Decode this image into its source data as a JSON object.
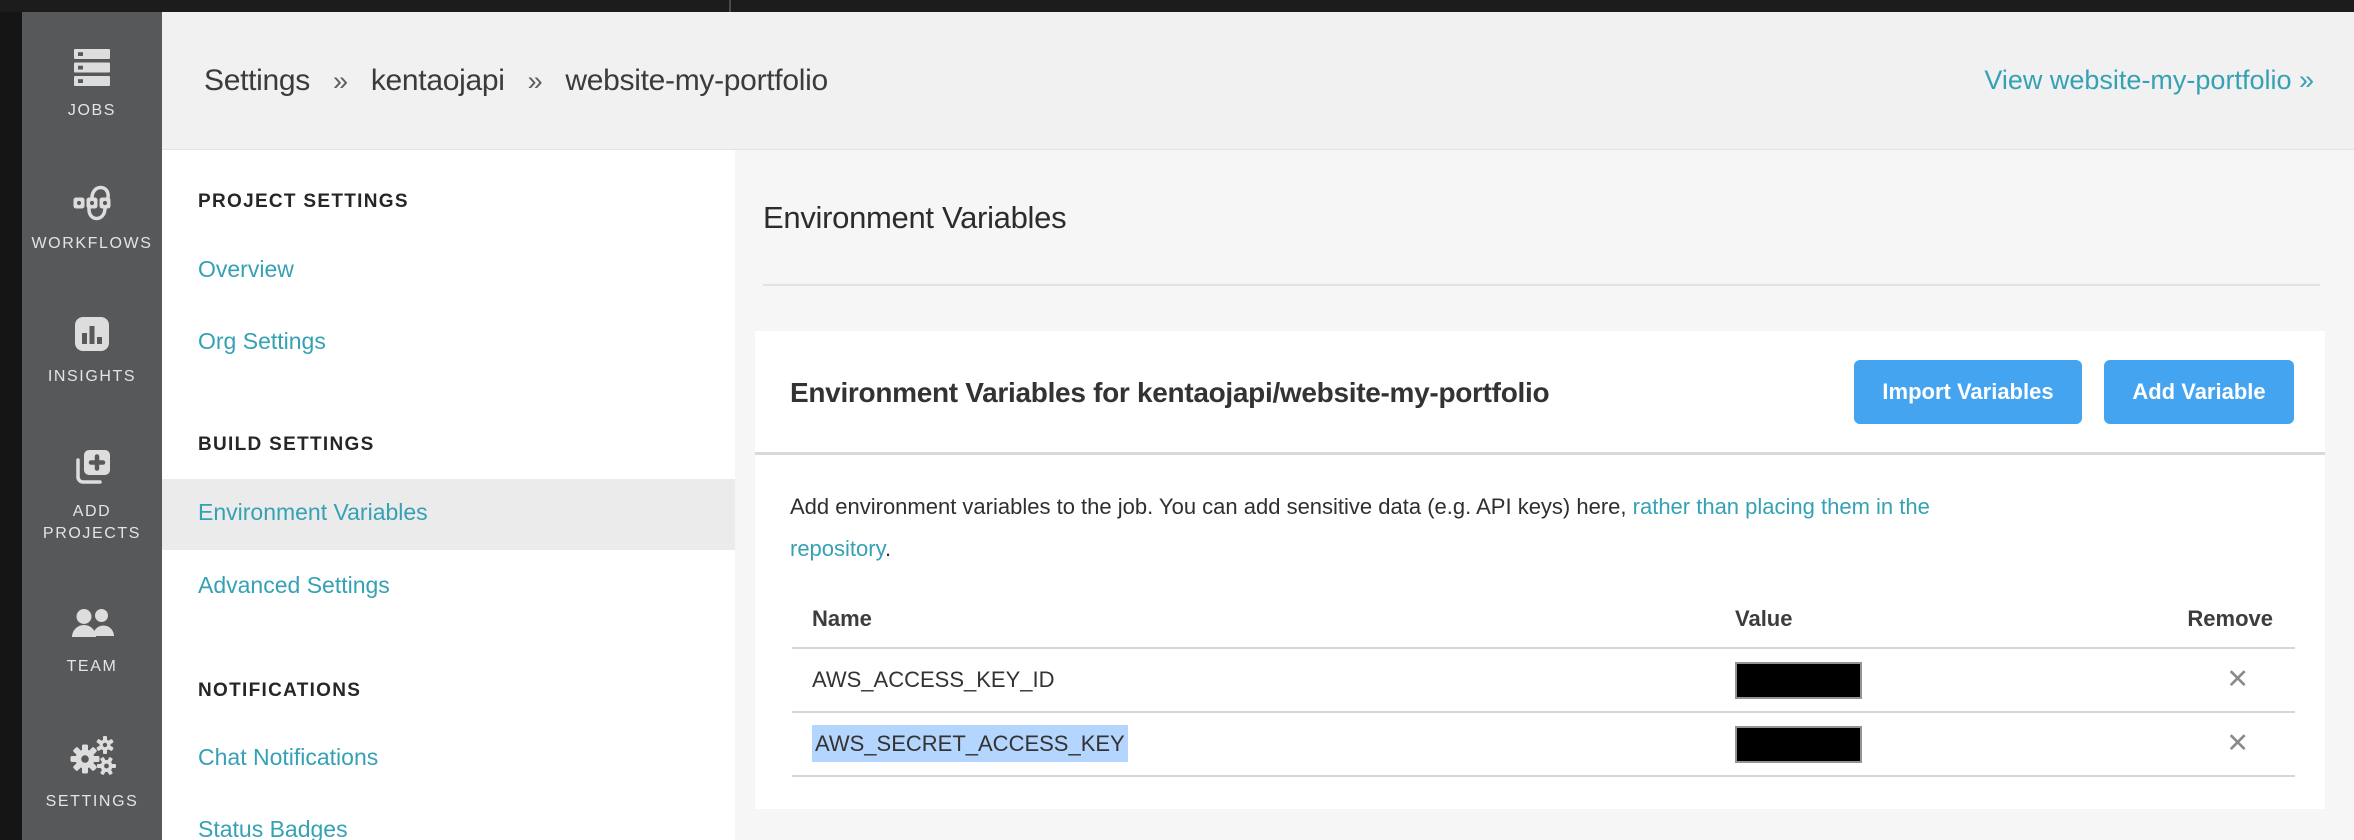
{
  "sidebar": {
    "items": [
      {
        "label": "JOBS",
        "icon": "jobs-icon"
      },
      {
        "label": "WORKFLOWS",
        "icon": "workflows-icon"
      },
      {
        "label": "INSIGHTS",
        "icon": "insights-icon"
      },
      {
        "label": "ADD PROJECTS",
        "icon": "add-projects-icon"
      },
      {
        "label": "TEAM",
        "icon": "team-icon"
      },
      {
        "label": "SETTINGS",
        "icon": "settings-icon"
      }
    ]
  },
  "header": {
    "breadcrumb": {
      "parts": [
        "Settings",
        "kentaojapi",
        "website-my-portfolio"
      ],
      "separator": "»"
    },
    "view_link": "View website-my-portfolio »"
  },
  "nav": {
    "sections": [
      {
        "heading": "PROJECT SETTINGS",
        "items": [
          {
            "label": "Overview"
          },
          {
            "label": "Org Settings"
          }
        ]
      },
      {
        "heading": "BUILD SETTINGS",
        "items": [
          {
            "label": "Environment Variables"
          },
          {
            "label": "Advanced Settings"
          }
        ]
      },
      {
        "heading": "NOTIFICATIONS",
        "items": [
          {
            "label": "Chat Notifications"
          },
          {
            "label": "Status Badges"
          }
        ]
      }
    ],
    "active_item": "Environment Variables"
  },
  "main": {
    "page_title": "Environment Variables",
    "card": {
      "title": "Environment Variables for kentaojapi/website-my-portfolio",
      "import_button": "Import Variables",
      "add_button": "Add Variable",
      "description": {
        "before_link": "Add environment variables to the job. You can add sensitive data (e.g. API keys) here, ",
        "link_line1": "rather than placing them in the",
        "link_line2": "repository",
        "after_link": "."
      },
      "table": {
        "headers": {
          "name": "Name",
          "value": "Value",
          "remove": "Remove"
        },
        "rows": [
          {
            "name": "AWS_ACCESS_KEY_ID",
            "value_redacted": true,
            "selected": false
          },
          {
            "name": "AWS_SECRET_ACCESS_KEY",
            "value_redacted": true,
            "selected": true
          }
        ],
        "remove_glyph": "✕"
      }
    }
  },
  "colors": {
    "teal_link": "#35a1b5",
    "button_blue": "#45a4f0",
    "selection_blue": "#b4d5fe",
    "sidebar_bg": "#57585a",
    "redaction": "#000000"
  }
}
